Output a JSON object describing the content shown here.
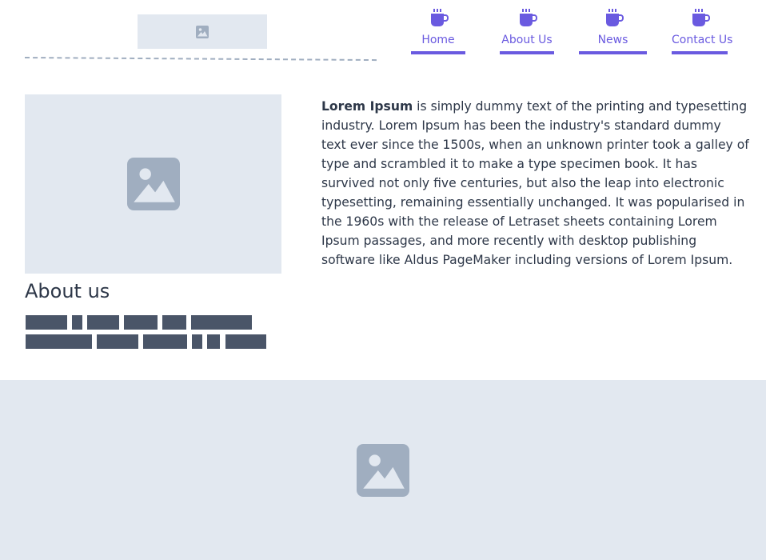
{
  "header": {
    "logo_icon": "image-placeholder-icon",
    "nav": [
      {
        "label": "Home",
        "icon": "coffee-cup-icon"
      },
      {
        "label": "About Us",
        "icon": "coffee-cup-icon"
      },
      {
        "label": "News",
        "icon": "coffee-cup-icon"
      },
      {
        "label": "Contact Us",
        "icon": "coffee-cup-icon"
      }
    ]
  },
  "main": {
    "image_icon": "image-placeholder-icon",
    "heading": "About us",
    "text_bold": "Lorem Ipsum",
    "text_rest": " is simply dummy text of the printing and typesetting industry. Lorem Ipsum has been the industry's standard dummy text ever since the 1500s, when an unknown printer took a galley of type and scrambled it to make a type specimen book. It has survived not only five centuries, but also the leap into electronic typesetting, remaining essentially unchanged. It was popularised in the 1960s with the release of Letraset sheets containing Lorem Ipsum passages, and more recently with desktop publishing software like Aldus PageMaker including versions of Lorem Ipsum."
  },
  "banner": {
    "image_icon": "image-placeholder-icon"
  },
  "colors": {
    "accent": "#6a5ae0",
    "placeholder_bg": "#e2e8f0",
    "placeholder_icon": "#a0aec0",
    "text": "#2d3748",
    "redacted": "#4a5568"
  }
}
